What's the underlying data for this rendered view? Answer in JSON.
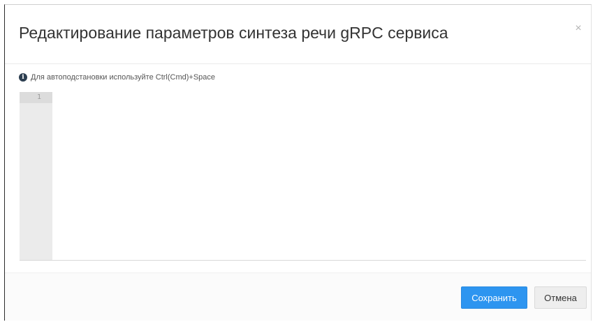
{
  "dialog": {
    "title": "Редактирование параметров синтеза речи gRPC сервиса",
    "close_symbol": "×"
  },
  "hint": {
    "icon": "info-icon",
    "icon_glyph": "i",
    "text": "Для автоподстановки используйте Ctrl(Cmd)+Space"
  },
  "editor": {
    "line_numbers": [
      "1"
    ],
    "content": ""
  },
  "footer": {
    "save_label": "Сохранить",
    "cancel_label": "Отмена",
    "colors": {
      "primary": "#2d95f0"
    }
  }
}
